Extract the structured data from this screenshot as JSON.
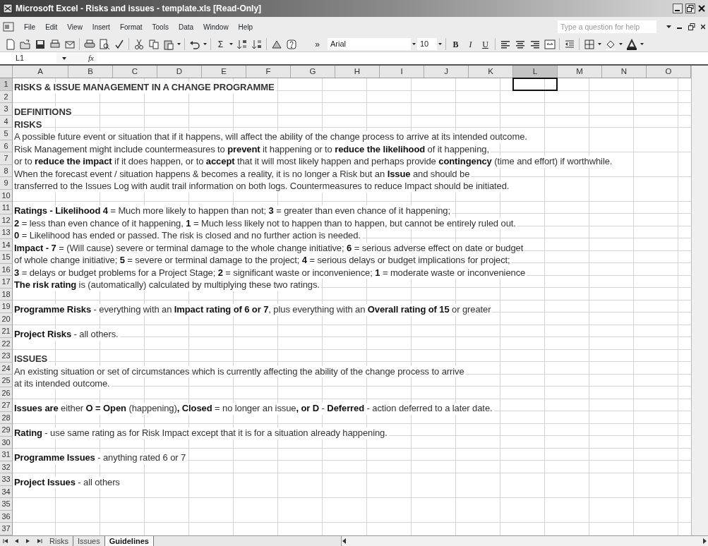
{
  "window": {
    "title": "Microsoft Excel - Risks and issues - template.xls  [Read-Only]"
  },
  "menu": [
    "File",
    "Edit",
    "View",
    "Insert",
    "Format",
    "Tools",
    "Data",
    "Window",
    "Help"
  ],
  "help_box": {
    "placeholder": "Type a question for help"
  },
  "toolbar": {
    "sum_label": "Σ",
    "overflow_label": "»",
    "font": "Arial",
    "size": "10",
    "format_buttons": [
      "B",
      "I",
      "U"
    ]
  },
  "formula_bar": {
    "name_box": "L1",
    "function_label": "fx"
  },
  "columns": [
    {
      "label": "A",
      "selected": false
    },
    {
      "label": "B",
      "selected": false
    },
    {
      "label": "C",
      "selected": false
    },
    {
      "label": "D",
      "selected": false
    },
    {
      "label": "E",
      "selected": false
    },
    {
      "label": "F",
      "selected": false
    },
    {
      "label": "G",
      "selected": false
    },
    {
      "label": "H",
      "selected": false
    },
    {
      "label": "I",
      "selected": false
    },
    {
      "label": "J",
      "selected": false
    },
    {
      "label": "K",
      "selected": false
    },
    {
      "label": "L",
      "selected": true
    },
    {
      "label": "M",
      "selected": false
    },
    {
      "label": "N",
      "selected": false
    },
    {
      "label": "O",
      "selected": false
    }
  ],
  "rows": [
    {
      "number": "1",
      "selected": true,
      "bold": true,
      "text": "RISKS & ISSUE MANAGEMENT IN A CHANGE PROGRAMME"
    },
    {
      "number": "2",
      "selected": false
    },
    {
      "number": "3",
      "selected": false,
      "bold": true,
      "text": "DEFINITIONS"
    },
    {
      "number": "4",
      "selected": false,
      "bold": true,
      "text": "RISKS"
    },
    {
      "number": "5",
      "selected": false,
      "text": "A possible future event or situation that if it happens, will affect the ability of the change process to arrive at its intended outcome."
    },
    {
      "number": "6",
      "selected": false,
      "text": "Risk Management might include  countermeasures to **prevent** it happening or to **reduce the likelihood** of it happening,"
    },
    {
      "number": "7",
      "selected": false,
      "text": "or to **reduce the impact** if it does happen, or to **accept** that it will most likely happen and perhaps provide **contingency** (time and effort) if worthwhile."
    },
    {
      "number": "8",
      "selected": false,
      "text": "When the forecast event / situation happens & becomes a reality, it is no longer a Risk but an **Issue** and should be"
    },
    {
      "number": "9",
      "selected": false,
      "text": "transferred to the Issues Log with audit trail information on both logs. Countermeasures to reduce Impact should be initiated."
    },
    {
      "number": "10",
      "selected": false
    },
    {
      "number": "11",
      "selected": false,
      "text": "**Ratings - Likelihood 4** = Much more likely to happen than not; **3** = greater than even chance of it happening;"
    },
    {
      "number": "12",
      "selected": false,
      "text": "**2** = less than even chance of it happening, **1** = Much less likely not to happen than to happen, but cannot be entirely ruled out."
    },
    {
      "number": "13",
      "selected": false,
      "text": "**0** = Likelihood has ended or passed.  The risk is closed and no further action is needed."
    },
    {
      "number": "14",
      "selected": false,
      "text": "**Impact - 7** = (Will cause) severe or terminal damage to the whole change initiative; **6** = serious adverse effect on date or budget"
    },
    {
      "number": "15",
      "selected": false,
      "text": "of whole change initiative; **5** = severe or terminal damage to the project; **4** = serious delays or budget implications for project;"
    },
    {
      "number": "16",
      "selected": false,
      "text": "**3** = delays or budget problems for a Project Stage; **2** = significant waste or inconvenience; **1** = moderate waste or inconvenience"
    },
    {
      "number": "17",
      "selected": false,
      "text": "**The risk rating** is (automatically) calculated by multiplying these  two ratings."
    },
    {
      "number": "18",
      "selected": false
    },
    {
      "number": "19",
      "selected": false,
      "text": "**Programme Risks** -  everything with an **Impact rating of  6 or 7**,  plus everything with an **Overall rating of 15** or greater"
    },
    {
      "number": "20",
      "selected": false
    },
    {
      "number": "21",
      "selected": false,
      "text": "**Project Risks** - all others."
    },
    {
      "number": "22",
      "selected": false
    },
    {
      "number": "23",
      "selected": false,
      "bold": true,
      "text": "ISSUES"
    },
    {
      "number": "24",
      "selected": false,
      "text": "An existing situation or set of circumstances which is currently affecting the ability of the change process to arrive"
    },
    {
      "number": "25",
      "selected": false,
      "text": "at its intended outcome."
    },
    {
      "number": "26",
      "selected": false
    },
    {
      "number": "27",
      "selected": false,
      "text": "**Issues are** either **O = Open** (happening)**, Closed** = no longer an issue**, or D** - **Deferred** - action deferred to a later date."
    },
    {
      "number": "28",
      "selected": false
    },
    {
      "number": "29",
      "selected": false,
      "text": "**Rating** - use same rating as for Risk Impact except that it is for a situation already happening."
    },
    {
      "number": "30",
      "selected": false
    },
    {
      "number": "31",
      "selected": false,
      "text": "**Programme Issues** - anything rated 6 or 7"
    },
    {
      "number": "32",
      "selected": false
    },
    {
      "number": "33",
      "selected": false,
      "text": "**Project Issues** - all others"
    },
    {
      "number": "34",
      "selected": false
    },
    {
      "number": "35",
      "selected": false
    },
    {
      "number": "36",
      "selected": false
    },
    {
      "number": "37",
      "selected": false
    }
  ],
  "sheet_tabs": [
    {
      "label": "Risks",
      "selected": false
    },
    {
      "label": "Issues",
      "selected": false
    },
    {
      "label": "Guidelines",
      "selected": true
    }
  ]
}
